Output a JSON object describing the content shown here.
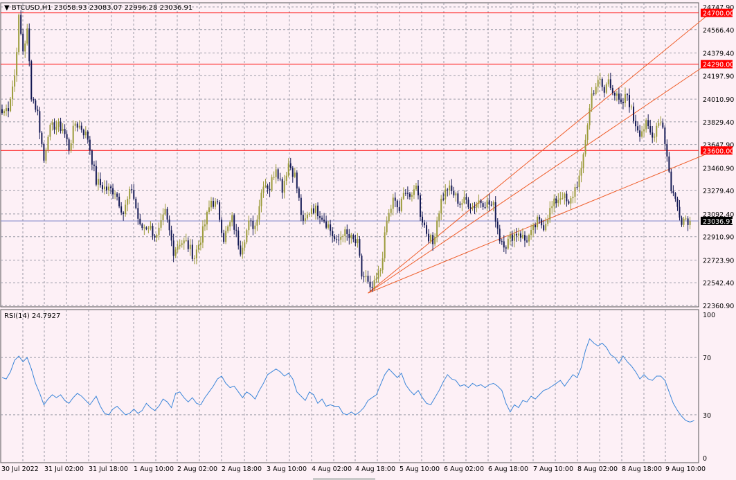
{
  "header": {
    "symbol_line": "▼ BTCUSD,H1  23058.93 23083.07 22996.28 23036.91",
    "current_price_label": "23036.91"
  },
  "indicator": {
    "label": "RSI(14) 24.7927",
    "levels": [
      "100",
      "70",
      "30",
      "0"
    ]
  },
  "colors": {
    "background": "#fdf0f6",
    "grid": "#9a9aa6",
    "bull_candle": "#9b9b3a",
    "bear_candle": "#141a55",
    "resistance_line": "#ff0000",
    "current_price_line": "#7f86c8",
    "fan_lines": "#ef5e2a",
    "rsi_line": "#3b86d9"
  },
  "chart_data": [
    {
      "type": "candlestick",
      "title": "BTCUSD,H1",
      "last_bar": {
        "open": 23058.93,
        "high": 23083.07,
        "low": 22996.28,
        "close": 23036.91
      },
      "ylim": [
        22360.9,
        24747.9
      ],
      "y_ticks": [
        "24747.90",
        "24566.40",
        "24379.40",
        "24197.90",
        "24010.90",
        "23829.40",
        "23647.90",
        "23460.90",
        "23279.40",
        "23092.40",
        "22910.90",
        "22723.90",
        "22542.40",
        "22360.90"
      ],
      "x_ticks": [
        "30 Jul 2022",
        "31 Jul 02:00",
        "31 Jul 18:00",
        "1 Aug 10:00",
        "2 Aug 02:00",
        "2 Aug 18:00",
        "3 Aug 10:00",
        "4 Aug 02:00",
        "4 Aug 18:00",
        "5 Aug 10:00",
        "6 Aug 02:00",
        "6 Aug 18:00",
        "7 Aug 10:00",
        "8 Aug 02:00",
        "8 Aug 18:00",
        "9 Aug 10:00"
      ],
      "horizontal_levels": [
        {
          "label": "24700.00",
          "value": 24700.0
        },
        {
          "label": "24290.00",
          "value": 24290.0
        },
        {
          "label": "23600.00",
          "value": 23600.0
        }
      ],
      "current_price": 23036.91,
      "close_path": [
        [
          0,
          23900
        ],
        [
          3,
          23950
        ],
        [
          6,
          24200
        ],
        [
          8,
          24650
        ],
        [
          10,
          24400
        ],
        [
          12,
          24550
        ],
        [
          14,
          24050
        ],
        [
          17,
          23900
        ],
        [
          20,
          23520
        ],
        [
          22,
          23750
        ],
        [
          25,
          23800
        ],
        [
          29,
          23780
        ],
        [
          32,
          23620
        ],
        [
          35,
          23820
        ],
        [
          38,
          23780
        ],
        [
          41,
          23700
        ],
        [
          45,
          23350
        ],
        [
          50,
          23290
        ],
        [
          54,
          23280
        ],
        [
          58,
          23100
        ],
        [
          62,
          23300
        ],
        [
          66,
          22980
        ],
        [
          70,
          23000
        ],
        [
          74,
          22900
        ],
        [
          78,
          23100
        ],
        [
          82,
          22800
        ],
        [
          85,
          22870
        ],
        [
          88,
          22860
        ],
        [
          92,
          22750
        ],
        [
          96,
          22950
        ],
        [
          100,
          23200
        ],
        [
          103,
          23150
        ],
        [
          106,
          22900
        ],
        [
          110,
          23050
        ],
        [
          114,
          22810
        ],
        [
          118,
          23010
        ],
        [
          121,
          23000
        ],
        [
          125,
          23350
        ],
        [
          128,
          23300
        ],
        [
          131,
          23480
        ],
        [
          134,
          23300
        ],
        [
          137,
          23500
        ],
        [
          140,
          23400
        ],
        [
          144,
          23000
        ],
        [
          148,
          23150
        ],
        [
          152,
          23100
        ],
        [
          156,
          23000
        ],
        [
          160,
          22850
        ],
        [
          163,
          22950
        ],
        [
          166,
          22900
        ],
        [
          170,
          22850
        ],
        [
          172,
          22600
        ],
        [
          174,
          22580
        ],
        [
          176,
          22470
        ],
        [
          178,
          22520
        ],
        [
          181,
          22650
        ],
        [
          184,
          23030
        ],
        [
          187,
          23200
        ],
        [
          190,
          23120
        ],
        [
          193,
          23300
        ],
        [
          196,
          23200
        ],
        [
          198,
          23350
        ],
        [
          200,
          23100
        ],
        [
          203,
          22950
        ],
        [
          206,
          22850
        ],
        [
          208,
          23050
        ],
        [
          210,
          23200
        ],
        [
          213,
          23300
        ],
        [
          216,
          23250
        ],
        [
          219,
          23180
        ],
        [
          222,
          23200
        ],
        [
          225,
          23150
        ],
        [
          228,
          23200
        ],
        [
          232,
          23180
        ],
        [
          235,
          23150
        ],
        [
          238,
          22900
        ],
        [
          241,
          22850
        ],
        [
          244,
          22920
        ],
        [
          247,
          22950
        ],
        [
          250,
          22880
        ],
        [
          253,
          22930
        ],
        [
          256,
          23030
        ],
        [
          259,
          23000
        ],
        [
          262,
          23120
        ],
        [
          265,
          23200
        ],
        [
          268,
          23250
        ],
        [
          271,
          23150
        ],
        [
          274,
          23300
        ],
        [
          277,
          23420
        ],
        [
          279,
          23700
        ],
        [
          282,
          24050
        ],
        [
          284,
          24120
        ],
        [
          286,
          24150
        ],
        [
          288,
          24060
        ],
        [
          290,
          24180
        ],
        [
          293,
          24050
        ],
        [
          296,
          23950
        ],
        [
          299,
          24050
        ],
        [
          302,
          23850
        ],
        [
          305,
          23750
        ],
        [
          308,
          23800
        ],
        [
          311,
          23700
        ],
        [
          314,
          23850
        ],
        [
          316,
          23800
        ],
        [
          318,
          23550
        ],
        [
          320,
          23300
        ],
        [
          322,
          23200
        ],
        [
          325,
          23050
        ],
        [
          327,
          23060
        ],
        [
          329,
          23036.91
        ]
      ],
      "fan_lines": [
        {
          "from": [
            175,
            22460
          ],
          "to": [
            338,
            24690
          ]
        },
        {
          "from": [
            175,
            22460
          ],
          "to": [
            338,
            24300
          ]
        },
        {
          "from": [
            175,
            22460
          ],
          "to": [
            338,
            23580
          ]
        }
      ]
    },
    {
      "type": "line",
      "title": "RSI(14) 24.7927",
      "ylim": [
        0,
        100
      ],
      "levels": [
        30,
        70
      ],
      "values": [
        [
          0,
          56
        ],
        [
          2,
          55
        ],
        [
          4,
          60
        ],
        [
          6,
          68
        ],
        [
          8,
          71
        ],
        [
          10,
          67
        ],
        [
          12,
          70
        ],
        [
          14,
          62
        ],
        [
          16,
          52
        ],
        [
          18,
          45
        ],
        [
          20,
          37
        ],
        [
          22,
          41
        ],
        [
          24,
          44
        ],
        [
          26,
          42
        ],
        [
          28,
          44
        ],
        [
          30,
          40
        ],
        [
          32,
          38
        ],
        [
          34,
          42
        ],
        [
          36,
          45
        ],
        [
          38,
          43
        ],
        [
          40,
          40
        ],
        [
          42,
          37
        ],
        [
          45,
          43
        ],
        [
          47,
          36
        ],
        [
          49,
          31
        ],
        [
          51,
          30
        ],
        [
          53,
          34
        ],
        [
          55,
          36
        ],
        [
          57,
          33
        ],
        [
          59,
          30
        ],
        [
          61,
          31
        ],
        [
          63,
          34
        ],
        [
          65,
          31
        ],
        [
          67,
          33
        ],
        [
          69,
          38
        ],
        [
          71,
          35
        ],
        [
          73,
          33
        ],
        [
          75,
          36
        ],
        [
          77,
          41
        ],
        [
          79,
          39
        ],
        [
          81,
          35
        ],
        [
          83,
          45
        ],
        [
          85,
          46
        ],
        [
          87,
          42
        ],
        [
          89,
          39
        ],
        [
          91,
          42
        ],
        [
          93,
          38
        ],
        [
          95,
          37
        ],
        [
          97,
          42
        ],
        [
          99,
          46
        ],
        [
          101,
          50
        ],
        [
          103,
          55
        ],
        [
          105,
          57
        ],
        [
          107,
          52
        ],
        [
          109,
          49
        ],
        [
          111,
          50
        ],
        [
          113,
          46
        ],
        [
          115,
          42
        ],
        [
          117,
          46
        ],
        [
          119,
          44
        ],
        [
          121,
          41
        ],
        [
          123,
          47
        ],
        [
          125,
          52
        ],
        [
          127,
          58
        ],
        [
          129,
          60
        ],
        [
          131,
          62
        ],
        [
          133,
          60
        ],
        [
          135,
          57
        ],
        [
          137,
          59
        ],
        [
          139,
          55
        ],
        [
          141,
          46
        ],
        [
          143,
          43
        ],
        [
          145,
          40
        ],
        [
          147,
          46
        ],
        [
          149,
          44
        ],
        [
          151,
          38
        ],
        [
          153,
          41
        ],
        [
          155,
          36
        ],
        [
          157,
          37
        ],
        [
          159,
          36
        ],
        [
          161,
          36
        ],
        [
          163,
          31
        ],
        [
          165,
          30
        ],
        [
          167,
          32
        ],
        [
          169,
          30
        ],
        [
          171,
          32
        ],
        [
          173,
          35
        ],
        [
          175,
          40
        ],
        [
          177,
          42
        ],
        [
          179,
          44
        ],
        [
          181,
          51
        ],
        [
          183,
          58
        ],
        [
          185,
          62
        ],
        [
          187,
          59
        ],
        [
          189,
          56
        ],
        [
          191,
          59
        ],
        [
          193,
          51
        ],
        [
          195,
          47
        ],
        [
          197,
          44
        ],
        [
          199,
          47
        ],
        [
          201,
          42
        ],
        [
          203,
          38
        ],
        [
          205,
          37
        ],
        [
          207,
          42
        ],
        [
          209,
          47
        ],
        [
          211,
          53
        ],
        [
          213,
          58
        ],
        [
          215,
          55
        ],
        [
          217,
          54
        ],
        [
          219,
          50
        ],
        [
          221,
          51
        ],
        [
          223,
          49
        ],
        [
          225,
          52
        ],
        [
          227,
          50
        ],
        [
          229,
          51
        ],
        [
          231,
          49
        ],
        [
          233,
          51
        ],
        [
          235,
          52
        ],
        [
          237,
          50
        ],
        [
          239,
          47
        ],
        [
          241,
          38
        ],
        [
          243,
          32
        ],
        [
          245,
          37
        ],
        [
          247,
          35
        ],
        [
          249,
          40
        ],
        [
          251,
          39
        ],
        [
          253,
          43
        ],
        [
          255,
          41
        ],
        [
          257,
          44
        ],
        [
          259,
          47
        ],
        [
          261,
          48
        ],
        [
          263,
          50
        ],
        [
          265,
          52
        ],
        [
          267,
          54
        ],
        [
          269,
          50
        ],
        [
          271,
          54
        ],
        [
          273,
          58
        ],
        [
          275,
          56
        ],
        [
          277,
          63
        ],
        [
          279,
          75
        ],
        [
          281,
          83
        ],
        [
          283,
          80
        ],
        [
          285,
          78
        ],
        [
          287,
          80
        ],
        [
          289,
          77
        ],
        [
          291,
          72
        ],
        [
          293,
          70
        ],
        [
          295,
          66
        ],
        [
          297,
          71
        ],
        [
          299,
          67
        ],
        [
          301,
          64
        ],
        [
          303,
          60
        ],
        [
          305,
          55
        ],
        [
          307,
          58
        ],
        [
          309,
          55
        ],
        [
          311,
          54
        ],
        [
          313,
          57
        ],
        [
          315,
          57
        ],
        [
          317,
          54
        ],
        [
          319,
          46
        ],
        [
          321,
          38
        ],
        [
          323,
          33
        ],
        [
          325,
          29
        ],
        [
          327,
          26
        ],
        [
          329,
          25
        ],
        [
          331,
          26
        ]
      ]
    }
  ]
}
